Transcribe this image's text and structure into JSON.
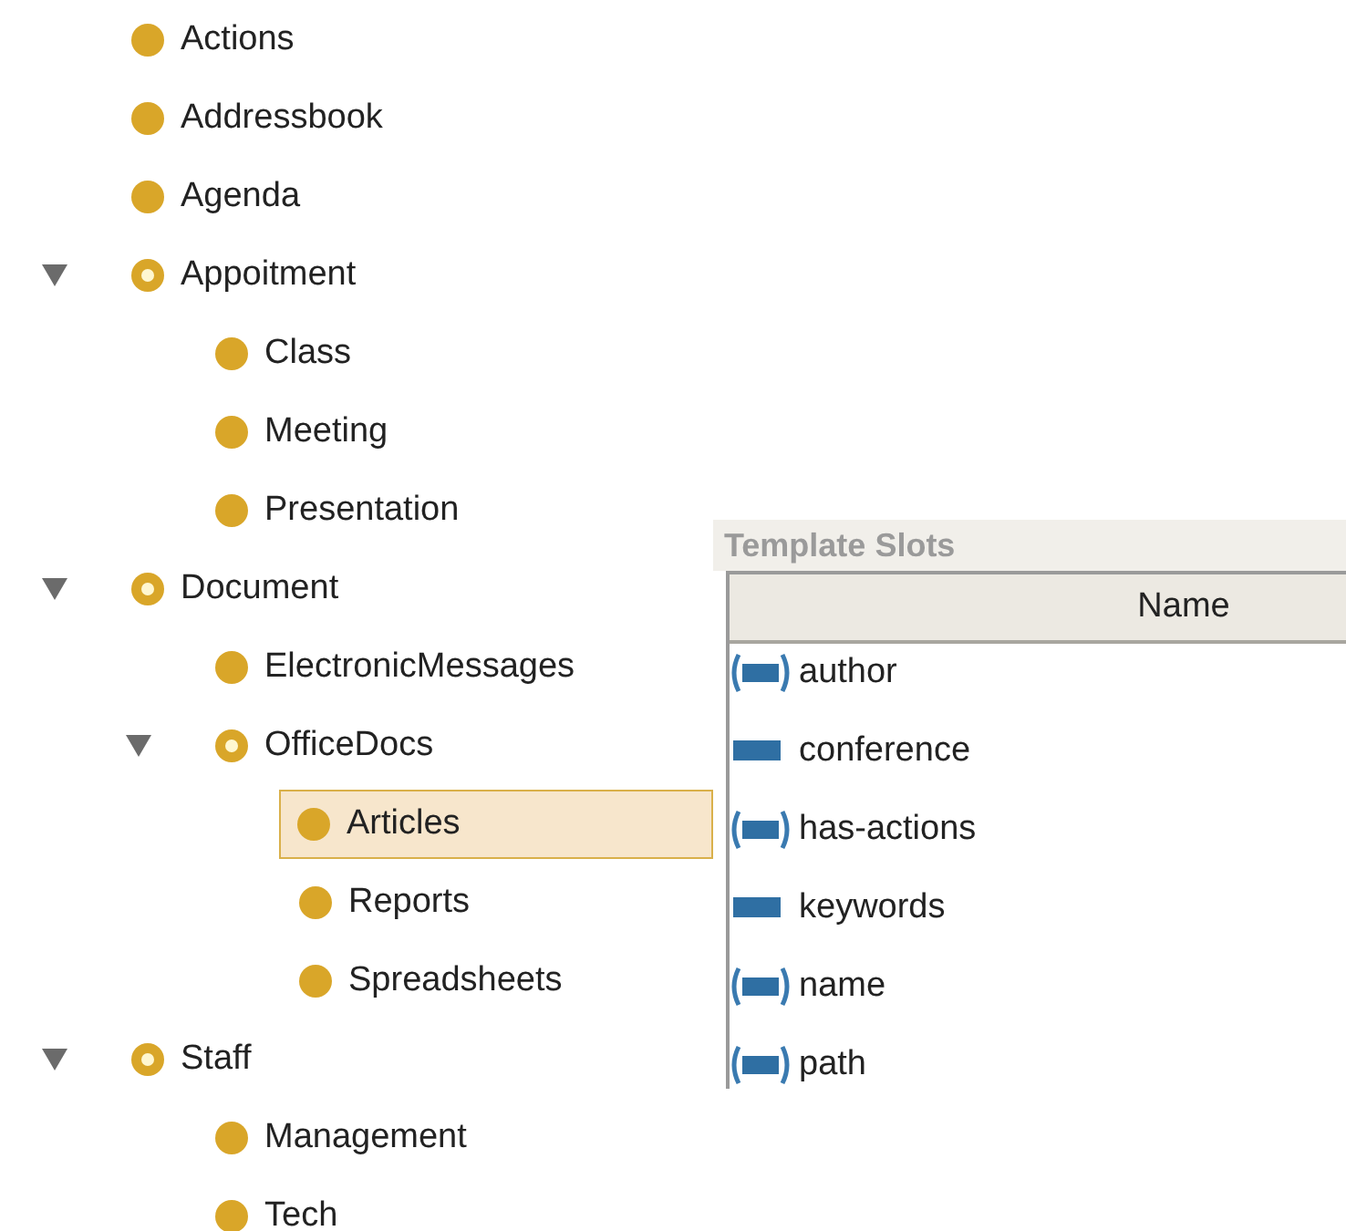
{
  "tree": [
    {
      "label": "Actions",
      "selected": false,
      "expanded": false
    },
    {
      "label": "Addressbook",
      "selected": false,
      "expanded": false
    },
    {
      "label": "Agenda",
      "selected": false,
      "expanded": false
    },
    {
      "label": "Appoitment",
      "selected": false,
      "expanded": true,
      "children": [
        {
          "label": "Class",
          "selected": false,
          "expanded": false
        },
        {
          "label": "Meeting",
          "selected": false,
          "expanded": false
        },
        {
          "label": "Presentation",
          "selected": false,
          "expanded": false
        }
      ]
    },
    {
      "label": "Document",
      "selected": false,
      "expanded": true,
      "children": [
        {
          "label": "ElectronicMessages",
          "selected": false,
          "expanded": false
        },
        {
          "label": "OfficeDocs",
          "selected": false,
          "expanded": true,
          "children": [
            {
              "label": "Articles",
              "selected": true,
              "expanded": false
            },
            {
              "label": "Reports",
              "selected": false,
              "expanded": false
            },
            {
              "label": "Spreadsheets",
              "selected": false,
              "expanded": false
            }
          ]
        }
      ]
    },
    {
      "label": "Staff",
      "selected": false,
      "expanded": true,
      "children": [
        {
          "label": "Management",
          "selected": false,
          "expanded": false
        },
        {
          "label": "Tech",
          "selected": false,
          "expanded": false
        }
      ]
    }
  ],
  "template_slots": {
    "title": "Template Slots",
    "columns": [
      "Name"
    ],
    "rows": [
      {
        "name": "author",
        "kind": "multiple"
      },
      {
        "name": "conference",
        "kind": "single"
      },
      {
        "name": "has-actions",
        "kind": "multiple"
      },
      {
        "name": "keywords",
        "kind": "single"
      },
      {
        "name": "name",
        "kind": "multiple"
      },
      {
        "name": "path",
        "kind": "multiple"
      }
    ]
  }
}
